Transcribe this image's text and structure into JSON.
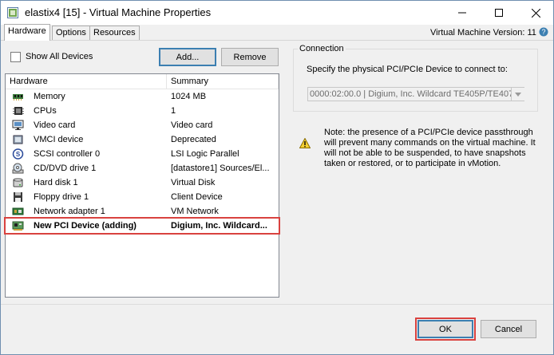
{
  "window": {
    "title": "elastix4 [15] - Virtual Machine Properties"
  },
  "tabs": [
    {
      "label": "Hardware"
    },
    {
      "label": "Options"
    },
    {
      "label": "Resources"
    }
  ],
  "vm_version": "Virtual Machine Version: 11",
  "hardware": {
    "show_all_label": "Show All Devices",
    "add_label": "Add...",
    "remove_label": "Remove",
    "columns": [
      "Hardware",
      "Summary"
    ],
    "rows": [
      {
        "icon": "memory-icon",
        "name": "Memory",
        "summary": "1024 MB"
      },
      {
        "icon": "cpu-icon",
        "name": "CPUs",
        "summary": "1"
      },
      {
        "icon": "monitor-icon",
        "name": "Video card",
        "summary": "Video card"
      },
      {
        "icon": "chip-icon",
        "name": "VMCI device",
        "summary": "Deprecated"
      },
      {
        "icon": "scsi-icon",
        "name": "SCSI controller 0",
        "summary": "LSI Logic Parallel"
      },
      {
        "icon": "cd-icon",
        "name": "CD/DVD drive 1",
        "summary": "[datastore1] Sources/El..."
      },
      {
        "icon": "disk-icon",
        "name": "Hard disk 1",
        "summary": "Virtual Disk"
      },
      {
        "icon": "floppy-icon",
        "name": "Floppy drive 1",
        "summary": "Client Device"
      },
      {
        "icon": "network-icon",
        "name": "Network adapter 1",
        "summary": "VM Network"
      },
      {
        "icon": "pci-icon",
        "name": "New PCI Device (adding)",
        "summary": "Digium, Inc. Wildcard..."
      }
    ]
  },
  "connection": {
    "legend": "Connection",
    "specify": "Specify the physical PCI/PCIe Device to connect to:",
    "device_value": "0000:02:00.0 | Digium, Inc. Wildcard TE405P/TE407",
    "note": "Note: the presence of a PCI/PCIe device passthrough will prevent many commands on the virtual machine. It will not be able to be suspended, to have snapshots taken or restored, or to participate in vMotion."
  },
  "footer": {
    "ok_label": "OK",
    "cancel_label": "Cancel"
  },
  "colors": {
    "highlight_red": "#d9423f",
    "accent_blue": "#3c7fb1"
  }
}
